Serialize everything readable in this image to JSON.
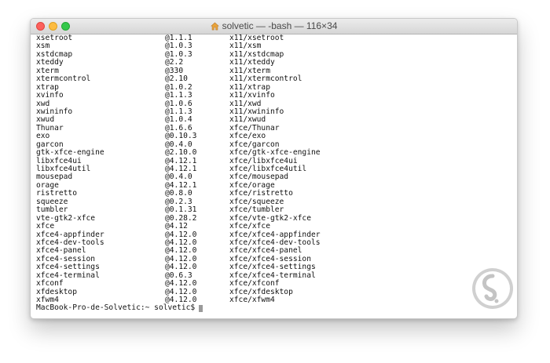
{
  "window": {
    "title": "solvetic — -bash — 116×34"
  },
  "terminal": {
    "rows": [
      {
        "name": "xsetroot",
        "version": "@1.1.1",
        "path": "x11/xsetroot"
      },
      {
        "name": "xsm",
        "version": "@1.0.3",
        "path": "x11/xsm"
      },
      {
        "name": "xstdcmap",
        "version": "@1.0.3",
        "path": "x11/xstdcmap"
      },
      {
        "name": "xteddy",
        "version": "@2.2",
        "path": "x11/xteddy"
      },
      {
        "name": "xterm",
        "version": "@330",
        "path": "x11/xterm"
      },
      {
        "name": "xtermcontrol",
        "version": "@2.10",
        "path": "x11/xtermcontrol"
      },
      {
        "name": "xtrap",
        "version": "@1.0.2",
        "path": "x11/xtrap"
      },
      {
        "name": "xvinfo",
        "version": "@1.1.3",
        "path": "x11/xvinfo"
      },
      {
        "name": "xwd",
        "version": "@1.0.6",
        "path": "x11/xwd"
      },
      {
        "name": "xwininfo",
        "version": "@1.1.3",
        "path": "x11/xwininfo"
      },
      {
        "name": "xwud",
        "version": "@1.0.4",
        "path": "x11/xwud"
      },
      {
        "name": "Thunar",
        "version": "@1.6.6",
        "path": "xfce/Thunar"
      },
      {
        "name": "exo",
        "version": "@0.10.3",
        "path": "xfce/exo"
      },
      {
        "name": "garcon",
        "version": "@0.4.0",
        "path": "xfce/garcon"
      },
      {
        "name": "gtk-xfce-engine",
        "version": "@2.10.0",
        "path": "xfce/gtk-xfce-engine"
      },
      {
        "name": "libxfce4ui",
        "version": "@4.12.1",
        "path": "xfce/libxfce4ui"
      },
      {
        "name": "libxfce4util",
        "version": "@4.12.1",
        "path": "xfce/libxfce4util"
      },
      {
        "name": "mousepad",
        "version": "@0.4.0",
        "path": "xfce/mousepad"
      },
      {
        "name": "orage",
        "version": "@4.12.1",
        "path": "xfce/orage"
      },
      {
        "name": "ristretto",
        "version": "@0.8.0",
        "path": "xfce/ristretto"
      },
      {
        "name": "squeeze",
        "version": "@0.2.3",
        "path": "xfce/squeeze"
      },
      {
        "name": "tumbler",
        "version": "@0.1.31",
        "path": "xfce/tumbler"
      },
      {
        "name": "vte-gtk2-xfce",
        "version": "@0.28.2",
        "path": "xfce/vte-gtk2-xfce"
      },
      {
        "name": "xfce",
        "version": "@4.12",
        "path": "xfce/xfce"
      },
      {
        "name": "xfce4-appfinder",
        "version": "@4.12.0",
        "path": "xfce/xfce4-appfinder"
      },
      {
        "name": "xfce4-dev-tools",
        "version": "@4.12.0",
        "path": "xfce/xfce4-dev-tools"
      },
      {
        "name": "xfce4-panel",
        "version": "@4.12.0",
        "path": "xfce/xfce4-panel"
      },
      {
        "name": "xfce4-session",
        "version": "@4.12.0",
        "path": "xfce/xfce4-session"
      },
      {
        "name": "xfce4-settings",
        "version": "@4.12.0",
        "path": "xfce/xfce4-settings"
      },
      {
        "name": "xfce4-terminal",
        "version": "@0.6.3",
        "path": "xfce/xfce4-terminal"
      },
      {
        "name": "xfconf",
        "version": "@4.12.0",
        "path": "xfce/xfconf"
      },
      {
        "name": "xfdesktop",
        "version": "@4.12.0",
        "path": "xfce/xfdesktop"
      },
      {
        "name": "xfwm4",
        "version": "@4.12.0",
        "path": "xfce/xfwm4"
      }
    ],
    "prompt": "MacBook-Pro-de-Solvetic:~ solvetic$"
  },
  "icons": {
    "title_icon": "home-icon",
    "watermark": "solvetic-logo"
  },
  "colors": {
    "close": "#fc605c",
    "minimize": "#fdbc40",
    "maximize": "#34c84a",
    "cursor": "#9a9a9a",
    "watermark": "#c9c9c9"
  }
}
